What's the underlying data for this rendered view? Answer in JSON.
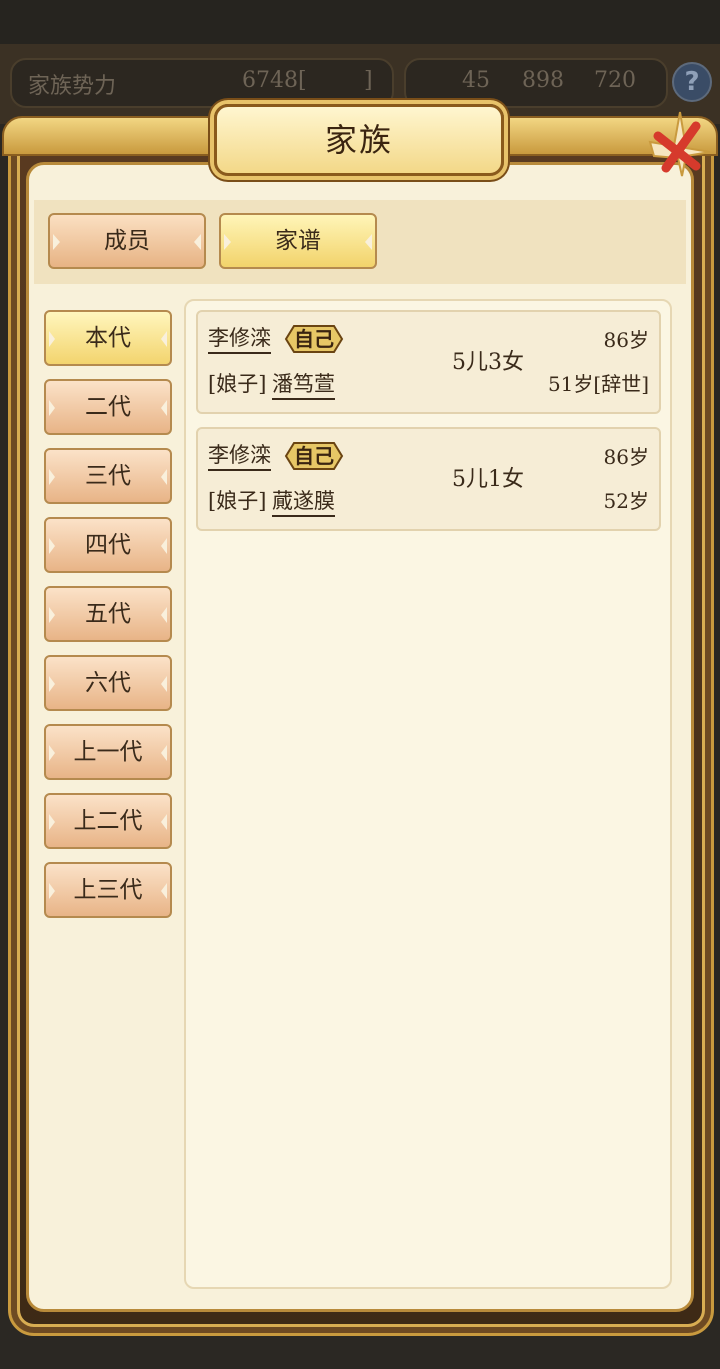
{
  "background": {
    "family_power_label": "家族势力",
    "family_power_value": "6748[",
    "family_power_suffix": "]",
    "resource_1": "45",
    "resource_2": "898",
    "resource_3": "720",
    "help_label": "?"
  },
  "dialog": {
    "title": "家族",
    "close_icon": "close-cross-icon"
  },
  "top_tabs": [
    {
      "label": "成员",
      "active": false
    },
    {
      "label": "家谱",
      "active": true
    }
  ],
  "generation_tabs": [
    {
      "label": "本代",
      "active": true
    },
    {
      "label": "二代",
      "active": false
    },
    {
      "label": "三代",
      "active": false
    },
    {
      "label": "四代",
      "active": false
    },
    {
      "label": "五代",
      "active": false
    },
    {
      "label": "六代",
      "active": false
    },
    {
      "label": "上一代",
      "active": false
    },
    {
      "label": "上二代",
      "active": false
    },
    {
      "label": "上三代",
      "active": false
    }
  ],
  "couples": [
    {
      "name": "李修滦",
      "self_badge": "自己",
      "spouse_prefix": "[娘子]",
      "spouse_name": "潘笃萱",
      "children": "5儿3女",
      "age": "86岁",
      "spouse_age": "51岁[辞世]"
    },
    {
      "name": "李修滦",
      "self_badge": "自己",
      "spouse_prefix": "[娘子]",
      "spouse_name": "蕆遂膜",
      "children": "5儿1女",
      "age": "86岁",
      "spouse_age": "52岁"
    }
  ],
  "colors": {
    "active_tab": "#f3d46e",
    "inactive_tab": "#e8b487",
    "panel_bg": "#f8f1da",
    "frame_gold": "#c99a3e",
    "close_red": "#d63a2c"
  }
}
